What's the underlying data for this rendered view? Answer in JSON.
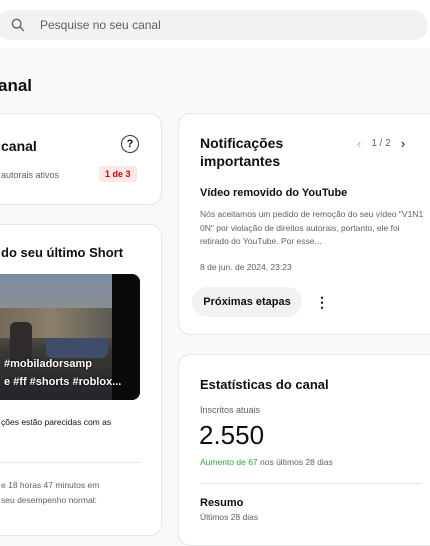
{
  "search": {
    "placeholder": "Pesquise no seu canal"
  },
  "page": {
    "title_partial": "anal"
  },
  "channel_card": {
    "title": "canal",
    "help_icon_label": "?",
    "copyright_text": "autorais ativos",
    "strike_badge": "1 de 3"
  },
  "short_card": {
    "title": "do seu último Short",
    "thumbnail_caption_line1": "#mobiladorsamp",
    "thumbnail_caption_line2": "e #ff #shorts #roblox...",
    "comparison_text": "ções estão parecidas com as",
    "time_text_line1": "e 18 horas 47 minutos em",
    "time_text_line2": "seu desempenho normal:"
  },
  "notifications_card": {
    "title": "Notificações importantes",
    "pager": "1 / 2",
    "item_title": "Vídeo removido do YouTube",
    "item_body": "Nós aceitamos um pedido de remoção do seu vídeo \"V1N1 0N\" por violação de direitos autorais, portanto, ele foi retirado do YouTube. Por esse...",
    "item_date": "8 de jun. de 2024, 23:23",
    "next_steps_label": "Próximas etapas",
    "more_label": "⋮"
  },
  "stats_card": {
    "title": "Estatísticas do canal",
    "subscribers_label": "Inscritos atuais",
    "subscribers_value": "2.550",
    "growth_highlight": "Aumento de 67",
    "growth_rest": " nos últimos 28 dias",
    "summary_title": "Resumo",
    "summary_sub": "Últimos 28 dias"
  },
  "colors": {
    "accent_green": "#2ba640",
    "badge_red": "#cc0000",
    "badge_bg": "#fde8e8"
  }
}
